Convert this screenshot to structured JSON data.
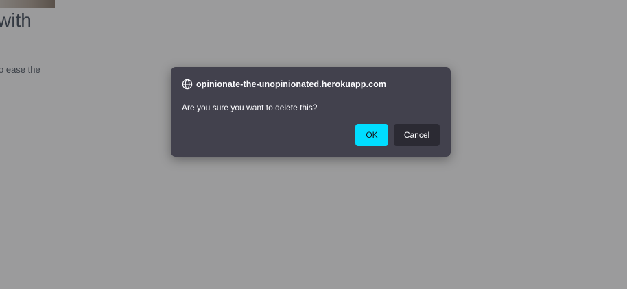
{
  "background_page": {
    "heading_fragment": "with",
    "text_fragment": "o ease the"
  },
  "dialog": {
    "origin": "opinionate-the-unopinionated.herokuapp.com",
    "origin_icon": "globe-icon",
    "message": "Are you sure you want to delete this?",
    "ok_label": "OK",
    "cancel_label": "Cancel"
  },
  "colors": {
    "dialog_background": "#42414d",
    "ok_button": "#00ddff",
    "cancel_button": "#2b2a33",
    "overlay": "#9a9a9b"
  }
}
